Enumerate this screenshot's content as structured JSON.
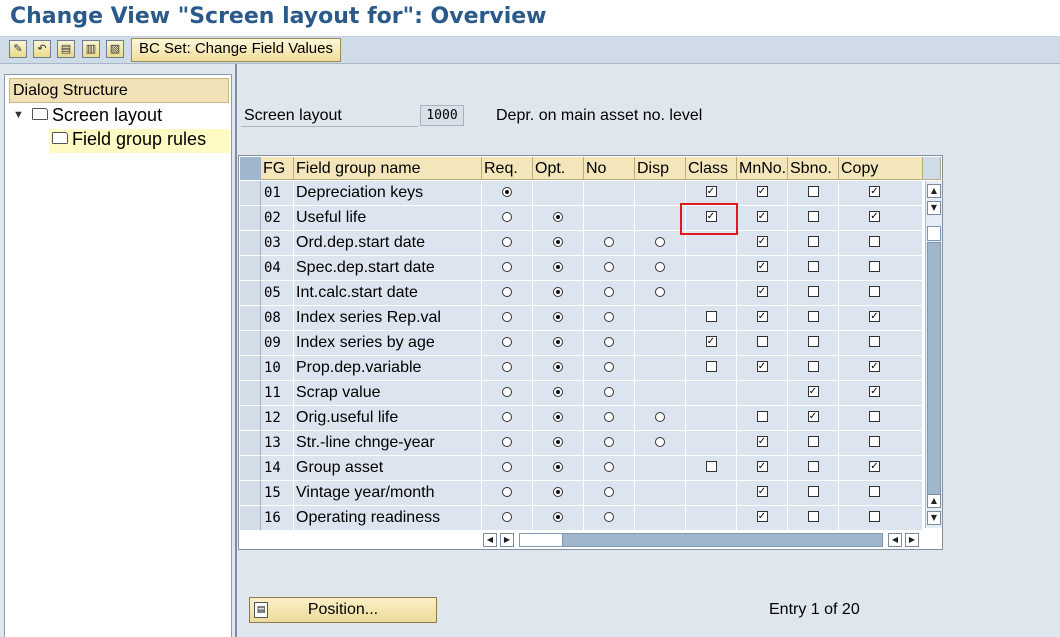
{
  "title": "Change View \"Screen layout for\": Overview",
  "toolbar": {
    "icons": [
      "edit-pencil-icon",
      "undo-icon",
      "select-all-icon",
      "select-block-icon",
      "deselect-icon"
    ],
    "bcset_label": "BC Set: Change Field Values"
  },
  "dialog": {
    "header": "Dialog Structure",
    "items": [
      {
        "label": "Screen layout",
        "expanded": true
      },
      {
        "label": "Field group rules",
        "selected": true
      }
    ]
  },
  "screen_layout": {
    "label": "Screen layout",
    "value": "1000",
    "description": "Depr. on main asset no. level"
  },
  "table": {
    "columns": [
      "FG",
      "Field group name",
      "Req.",
      "Opt.",
      "No",
      "Disp",
      "Class",
      "MnNo.",
      "Sbno.",
      "Copy"
    ],
    "rows": [
      {
        "fg": "01",
        "name": "Depreciation keys",
        "radio": "req",
        "radios": [
          "req"
        ],
        "class": true,
        "mnno": true,
        "sbno": false,
        "copy": true
      },
      {
        "fg": "02",
        "name": "Useful life",
        "radio": "opt",
        "radios": [
          "req",
          "opt"
        ],
        "class": true,
        "mnno": true,
        "sbno": false,
        "copy": true
      },
      {
        "fg": "03",
        "name": "Ord.dep.start date",
        "radio": "opt",
        "radios": [
          "req",
          "opt",
          "no",
          "disp"
        ],
        "class": null,
        "mnno": true,
        "sbno": false,
        "copy": false
      },
      {
        "fg": "04",
        "name": "Spec.dep.start date",
        "radio": "opt",
        "radios": [
          "req",
          "opt",
          "no",
          "disp"
        ],
        "class": null,
        "mnno": true,
        "sbno": false,
        "copy": false
      },
      {
        "fg": "05",
        "name": "Int.calc.start date",
        "radio": "opt",
        "radios": [
          "req",
          "opt",
          "no",
          "disp"
        ],
        "class": null,
        "mnno": true,
        "sbno": false,
        "copy": false
      },
      {
        "fg": "08",
        "name": "Index series Rep.val",
        "radio": "opt",
        "radios": [
          "req",
          "opt",
          "no"
        ],
        "class": false,
        "mnno": true,
        "sbno": false,
        "copy": true
      },
      {
        "fg": "09",
        "name": "Index series by age",
        "radio": "opt",
        "radios": [
          "req",
          "opt",
          "no"
        ],
        "class": true,
        "mnno": false,
        "sbno": false,
        "copy": false
      },
      {
        "fg": "10",
        "name": "Prop.dep.variable",
        "radio": "opt",
        "radios": [
          "req",
          "opt",
          "no"
        ],
        "class": false,
        "mnno": true,
        "sbno": false,
        "copy": true
      },
      {
        "fg": "11",
        "name": "Scrap value",
        "radio": "opt",
        "radios": [
          "req",
          "opt",
          "no"
        ],
        "class": null,
        "mnno": null,
        "sbno": true,
        "copy": true
      },
      {
        "fg": "12",
        "name": "Orig.useful life",
        "radio": "opt",
        "radios": [
          "req",
          "opt",
          "no",
          "disp"
        ],
        "class": null,
        "mnno": false,
        "sbno": true,
        "copy": false
      },
      {
        "fg": "13",
        "name": "Str.-line chnge-year",
        "radio": "opt",
        "radios": [
          "req",
          "opt",
          "no",
          "disp"
        ],
        "class": null,
        "mnno": true,
        "sbno": false,
        "copy": false
      },
      {
        "fg": "14",
        "name": "Group asset",
        "radio": "opt",
        "radios": [
          "req",
          "opt",
          "no"
        ],
        "class": false,
        "mnno": true,
        "sbno": false,
        "copy": true
      },
      {
        "fg": "15",
        "name": "Vintage year/month",
        "radio": "opt",
        "radios": [
          "req",
          "opt",
          "no"
        ],
        "class": null,
        "mnno": true,
        "sbno": false,
        "copy": false
      },
      {
        "fg": "16",
        "name": "Operating readiness",
        "radio": "opt",
        "radios": [
          "req",
          "opt",
          "no"
        ],
        "class": null,
        "mnno": true,
        "sbno": false,
        "copy": false
      }
    ]
  },
  "position_button": "Position...",
  "entry_text": "Entry 1 of 20"
}
